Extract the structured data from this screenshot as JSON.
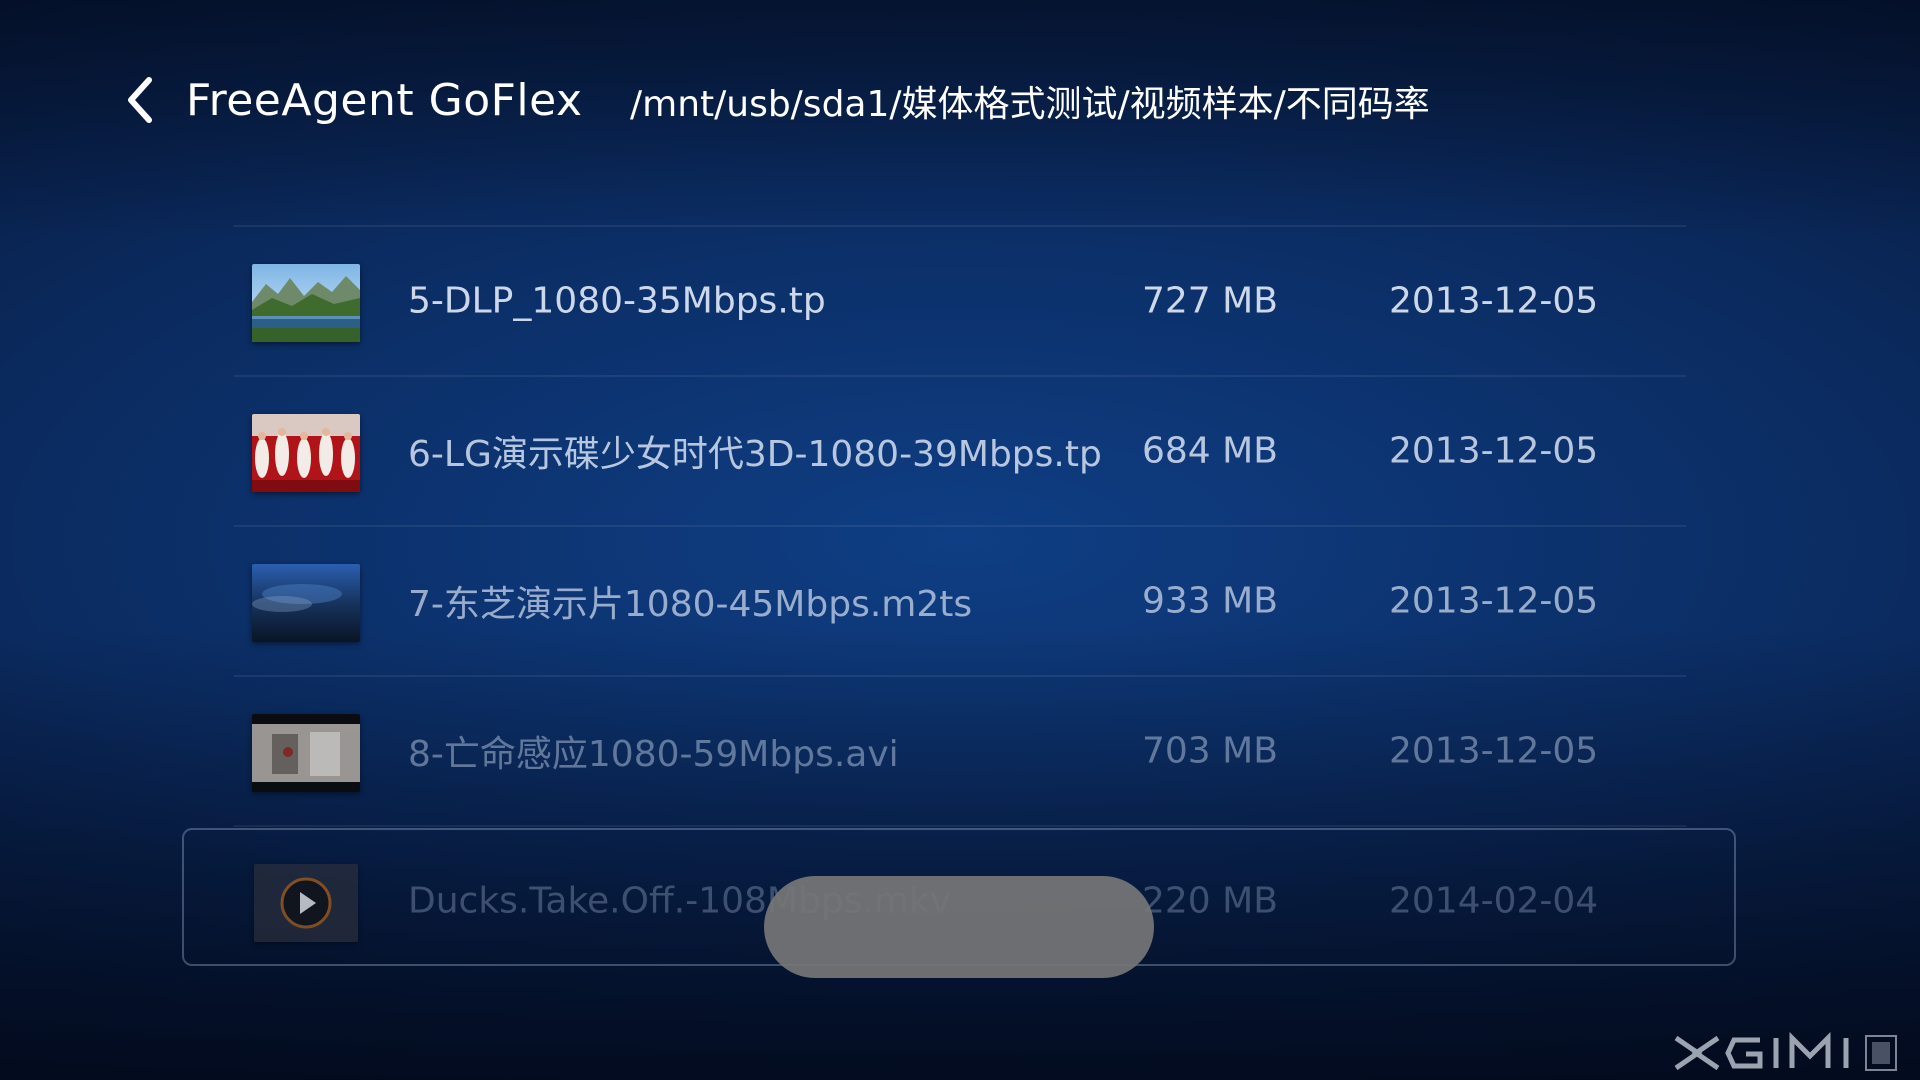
{
  "header": {
    "back_icon": "chevron-left-icon",
    "title": "FreeAgent GoFlex",
    "path": "/mnt/usb/sda1/媒体格式测试/视频样本/不同码率"
  },
  "files": [
    {
      "name": "5-DLP_1080-35Mbps.tp",
      "size": "727 MB",
      "date": "2013-12-05",
      "thumbnail": "landscape-lake-thumbnail"
    },
    {
      "name": "6-LG演示碟少女时代3D-1080-39Mbps.tp",
      "size": "684 MB",
      "date": "2013-12-05",
      "thumbnail": "red-dancers-thumbnail"
    },
    {
      "name": "7-东芝演示片1080-45Mbps.m2ts",
      "size": "933 MB",
      "date": "2013-12-05",
      "thumbnail": "dark-sky-thumbnail"
    },
    {
      "name": "8-亡命感应1080-59Mbps.avi",
      "size": "703 MB",
      "date": "2013-12-05",
      "thumbnail": "movie-scene-thumbnail"
    },
    {
      "name": "Ducks.Take.Off.-108Mbps.mkv",
      "size": "220 MB",
      "date": "2014-02-04",
      "thumbnail": "play-icon"
    }
  ],
  "toast": {
    "text": ""
  },
  "brand": {
    "logo": "XGIMI"
  },
  "colors": {
    "background_center": "#0f3e84",
    "background_edge": "#030b1e",
    "text": "#ffffff",
    "toast": "#767676"
  }
}
